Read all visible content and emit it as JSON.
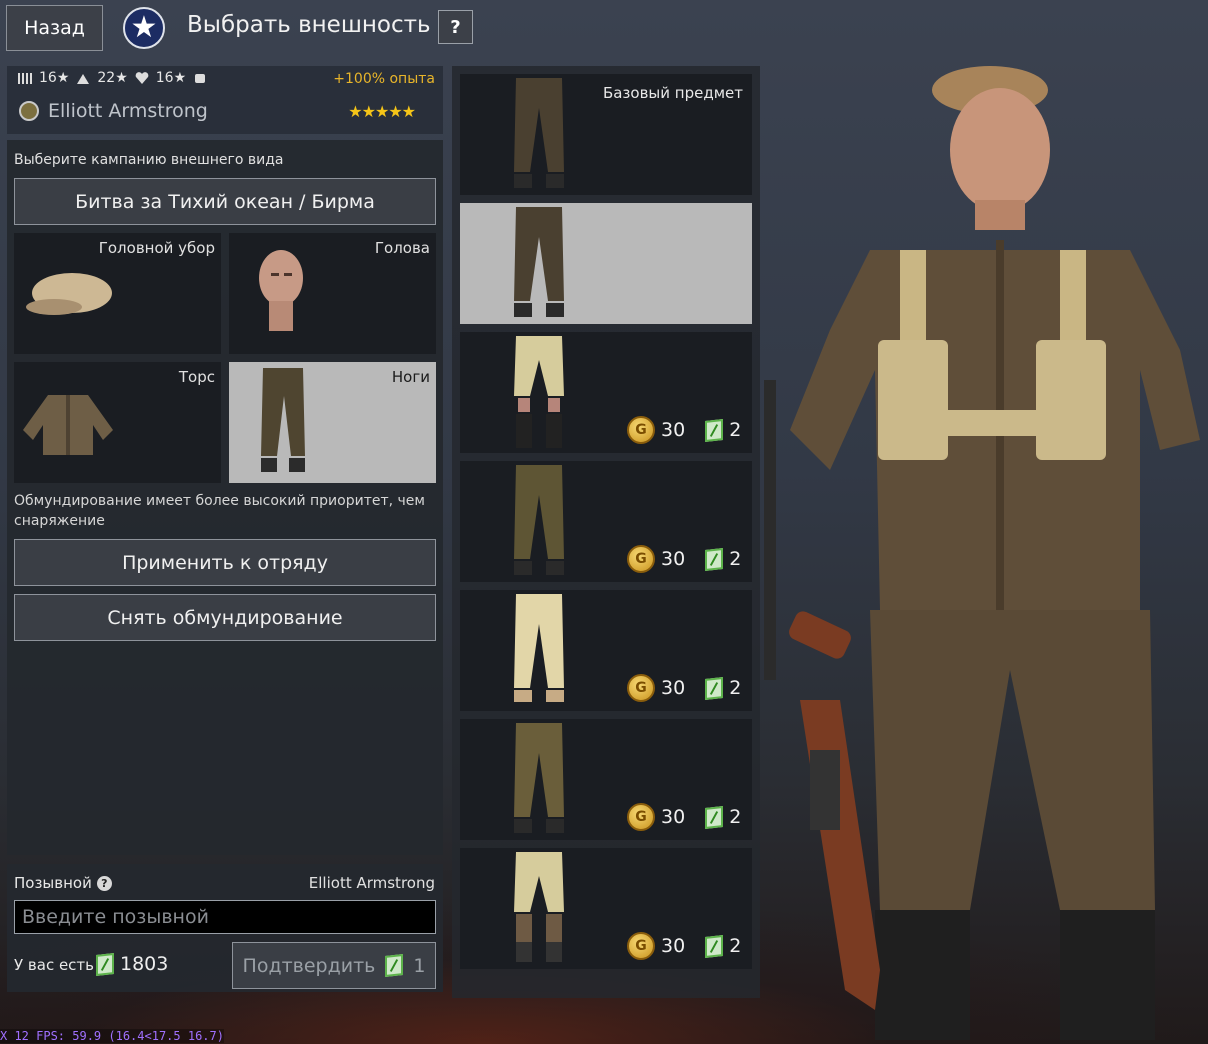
{
  "header": {
    "back_label": "Назад",
    "title": "Выбрать внешность",
    "help_label": "?",
    "nation_icon": "usa-star-emblem"
  },
  "soldier": {
    "stats": [
      {
        "icon": "squad-icon",
        "value": ""
      },
      {
        "icon": "speed-icon",
        "value": "16★"
      },
      {
        "icon": "health-icon",
        "value": "22★"
      },
      {
        "icon": "strength-icon",
        "value": "16★"
      }
    ],
    "xp_bonus": "+100% опыта",
    "name": "Elliott Armstrong",
    "stars": "★★★★★"
  },
  "appearance": {
    "campaign_prompt": "Выберите кампанию внешнего вида",
    "campaign": "Битва за Тихий океан / Бирма",
    "slots": {
      "headwear": "Головной убор",
      "head": "Голова",
      "torso": "Торс",
      "legs": "Ноги"
    },
    "priority_note": "Обмундирование имеет более высокий приоритет, чем снаряжение",
    "apply_label": "Применить к отряду",
    "remove_label": "Снять обмундирование"
  },
  "callsign": {
    "label": "Позывной",
    "current": "Elliott Armstrong",
    "placeholder": "Введите позывной",
    "balance_label": "У вас есть",
    "balance": "1803",
    "confirm_label": "Подтвердить",
    "confirm_cost": "1"
  },
  "items": [
    {
      "label": "Базовый предмет",
      "gold": "",
      "tickets": "",
      "color": "#4a4030"
    },
    {
      "label": "",
      "gold": "",
      "tickets": "",
      "color": "#4a4030"
    },
    {
      "label": "",
      "gold": "30",
      "tickets": "2",
      "color": "#d6cc9c"
    },
    {
      "label": "",
      "gold": "30",
      "tickets": "2",
      "color": "#5e5534"
    },
    {
      "label": "",
      "gold": "30",
      "tickets": "2",
      "color": "#e2d6a8"
    },
    {
      "label": "",
      "gold": "30",
      "tickets": "2",
      "color": "#6a5e3a"
    },
    {
      "label": "",
      "gold": "30",
      "tickets": "2",
      "color": "#d6cc9c"
    }
  ],
  "debug": {
    "fps": "X 12 FPS: 59.9 (16.4<17.5 16.7)"
  }
}
